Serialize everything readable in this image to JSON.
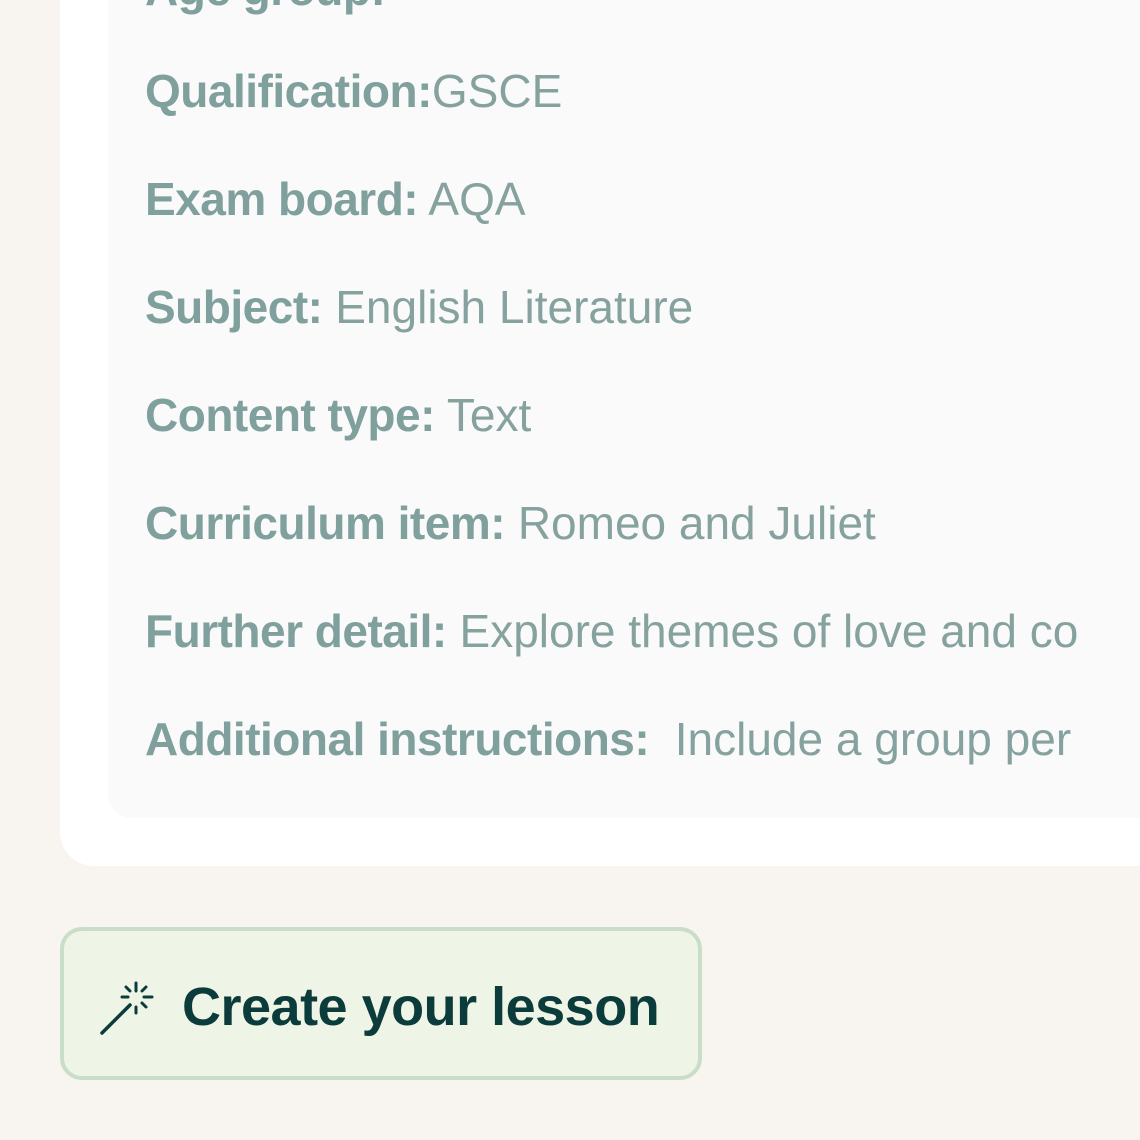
{
  "details": {
    "clipped_heading": "Age group:",
    "rows": [
      {
        "label": "Qualification:",
        "value": "GSCE"
      },
      {
        "label": "Exam board:",
        "value": "AQA"
      },
      {
        "label": "Subject:",
        "value": "English Literature"
      },
      {
        "label": "Content type:",
        "value": "Text"
      },
      {
        "label": "Curriculum item:",
        "value": "Romeo and Juliet"
      },
      {
        "label": "Further detail:",
        "value": "Explore themes of love and co"
      },
      {
        "label": "Additional instructions:",
        "value": "Include a group per"
      }
    ]
  },
  "actions": {
    "create_label": "Create your lesson",
    "create_icon": "magic-wand-icon"
  },
  "colors": {
    "page_background": "#f8f4ef",
    "label_text": "#7fa09c",
    "button_background": "#eff5e6",
    "button_border": "#c9ddc9",
    "button_text": "#0c3b3b"
  }
}
